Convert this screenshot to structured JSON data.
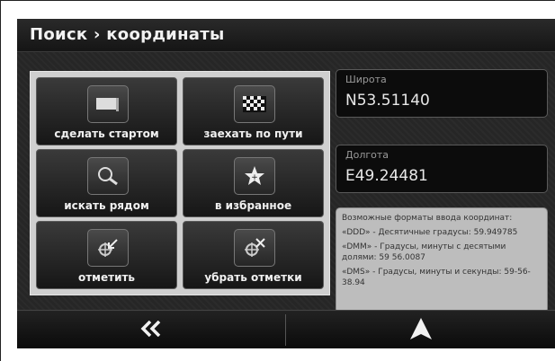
{
  "header": {
    "title": "Поиск › координаты"
  },
  "actions": [
    {
      "label": "сделать стартом",
      "icon": "flag-icon"
    },
    {
      "label": "заехать по пути",
      "icon": "checkered-flag-icon"
    },
    {
      "label": "искать рядом",
      "icon": "search-icon"
    },
    {
      "label": "в избранное",
      "icon": "favorite-star-icon"
    },
    {
      "label": "отметить",
      "icon": "mark-location-icon"
    },
    {
      "label": "убрать отметки",
      "icon": "remove-marks-icon"
    }
  ],
  "latitude": {
    "label": "Широта",
    "value": "N53.51140"
  },
  "longitude": {
    "label": "Долгота",
    "value": "E49.24481"
  },
  "formats": {
    "heading": "Возможные форматы ввода координат:",
    "ddd": "«DDD» - Десятичные градусы: 59.949785",
    "dmm": "«DMM» - Градусы, минуты с десятыми долями: 59 56.0087",
    "dms": "«DMS» - Градусы, минуты и секунды: 59-56-38.94"
  },
  "footer": {
    "back_icon": "double-chevron-left-icon",
    "navigate_icon": "navigation-arrow-icon"
  }
}
